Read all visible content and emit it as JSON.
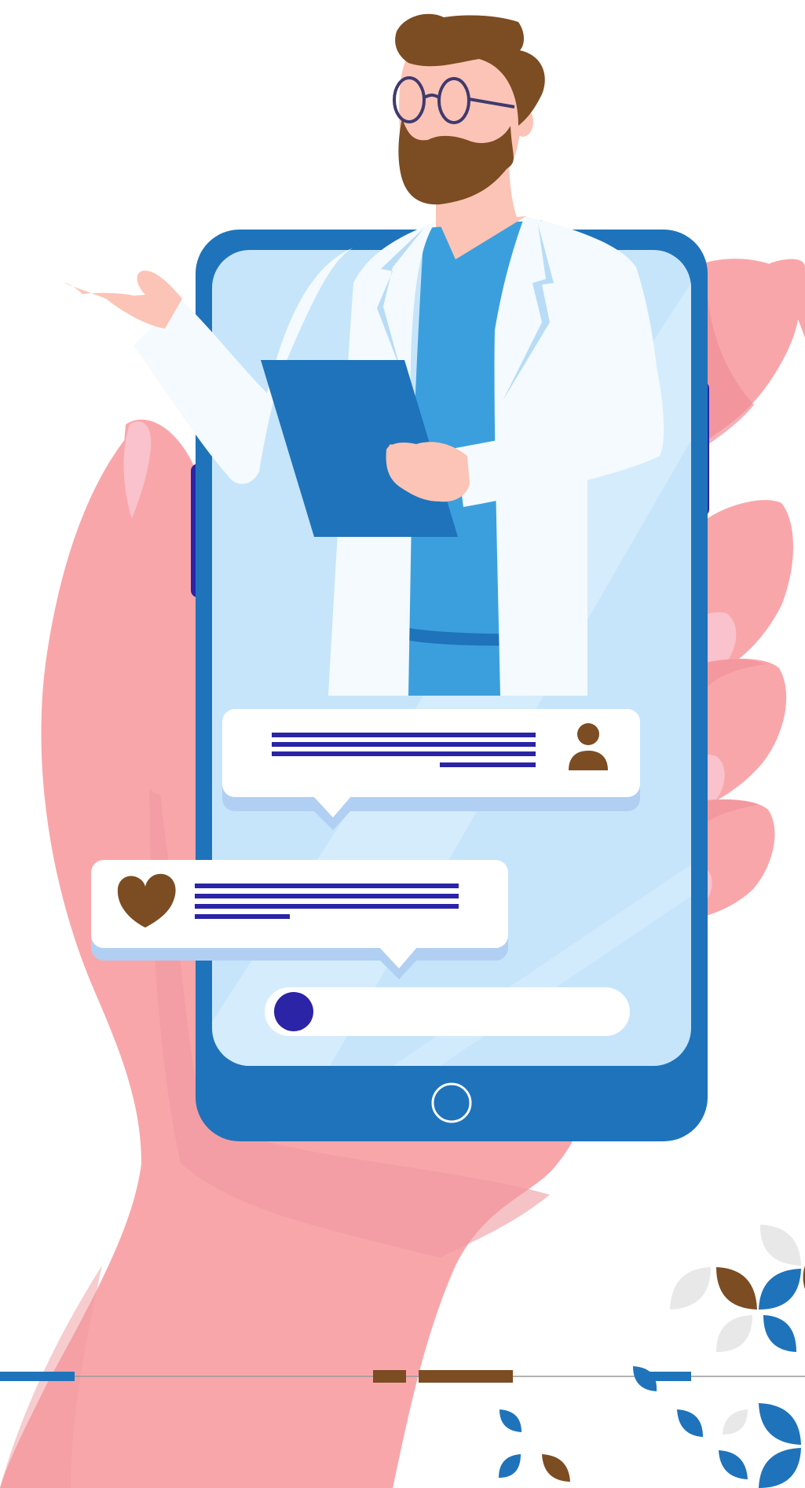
{
  "illustration": {
    "subject": "telemedicine-doctor-on-phone",
    "palette": {
      "background": "#ffffff",
      "skin_hand": "#f9a6aa",
      "skin_hand_shadow": "#ef8f96",
      "nail": "#f9c2cc",
      "phone_frame": "#1f73ba",
      "phone_side_button": "#2b24a6",
      "screen": "#c6e5fb",
      "screen_light": "#dbeffd",
      "doctor_skin": "#fcc4b6",
      "hair_beard": "#7c4c22",
      "glasses": "#3f3a6e",
      "scrubs": "#3c9fdd",
      "coat": "#f4fafd",
      "clipboard": "#1f73ba",
      "bubble": "#ffffff",
      "bubble_shadow": "#b1cff2",
      "text_lines": "#2b24a6",
      "accent_brown": "#7c4c22",
      "accent_blue": "#1f73ba",
      "accent_grey": "#e8e8e8"
    },
    "icons": {
      "user_bubble_icon": "user-icon",
      "heart_bubble_icon": "heart-icon",
      "input_bar_dot": "record-dot-icon",
      "home_button": "home-button-icon"
    }
  }
}
